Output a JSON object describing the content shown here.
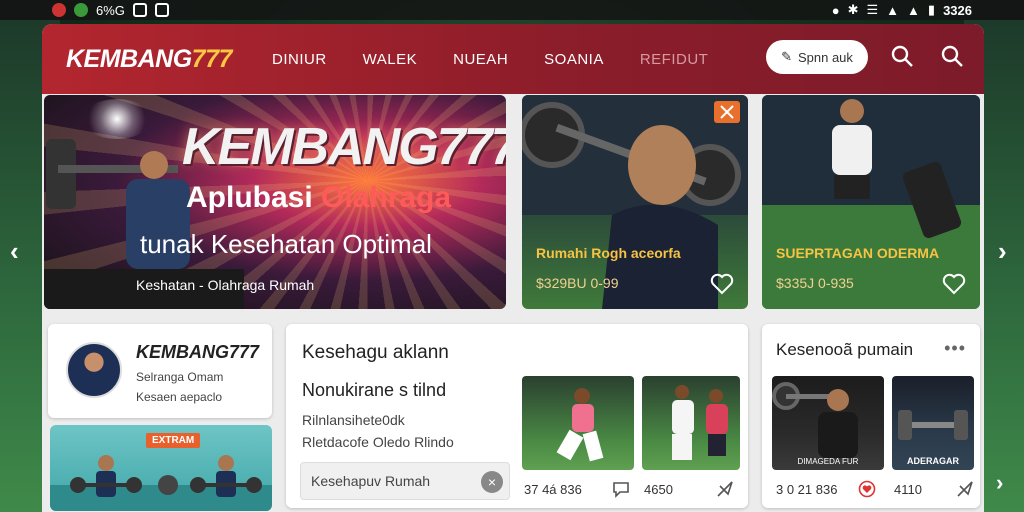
{
  "status_bar": {
    "left_text": "6%G",
    "time": "3326"
  },
  "header": {
    "logo_main": "KEMBANG",
    "logo_num": "777",
    "nav": [
      "DINIUR",
      "WALEK",
      "NUEAH",
      "SOANIA",
      "REFIDUT"
    ],
    "signin_label": "Spnn auk",
    "icons": [
      "search-icon",
      "search-icon"
    ]
  },
  "hero": {
    "title": "KEMBANG777",
    "subtitle_part1": "Aplubasi ",
    "subtitle_part2": "Olahraga",
    "subtitle2": "tunak Kesehatan Optimal",
    "caption": "Keshatan - Olahraga Rumah"
  },
  "cards": [
    {
      "caption": "Rumahi  Rogh aceorfa",
      "price": "$329BU 0-99"
    },
    {
      "caption": "SUEPRTAGAN ODERMA",
      "price": "$335J 0-935"
    }
  ],
  "profile": {
    "title": "KEMBANG777",
    "line1": "Selranga Omam",
    "line2": "Kesaen aepaclo"
  },
  "gym_banner": {
    "badge": "EXTRAM"
  },
  "middle_panel": {
    "title": "Kesehagu aklann",
    "subtitle": "Nonukirane s tilnd",
    "line1": "Rilnlansihete0dk",
    "line2": "Rletdacofe Oledo Rlindo",
    "input_value": "Kesehapuv Rumah",
    "meta1": "37 4á 836",
    "meta2": "4650"
  },
  "right_panel": {
    "title": "Kesenooã pumain",
    "thumb_label": "ADERAGAR",
    "thumb_label_left": "DIMAGEDA FUR",
    "meta1": "3 0 21 836",
    "meta2": "4110"
  },
  "colors": {
    "header_red": "#b3262f",
    "accent_gold": "#f6c343"
  }
}
